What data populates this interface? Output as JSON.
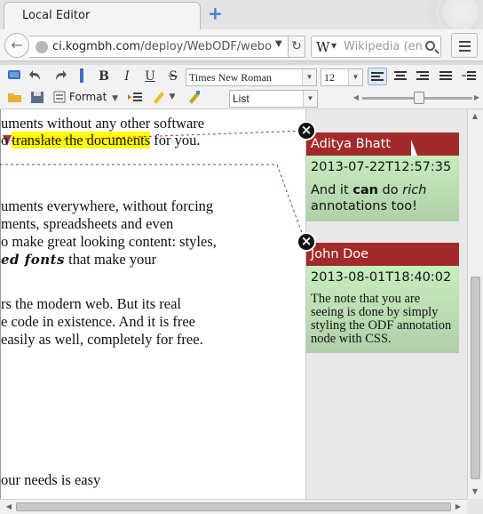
{
  "browser": {
    "tab_title": "Local Editor",
    "url_domain": "ci.kogmbh.com",
    "url_path": "/deploy/WebODF/webo",
    "search_placeholder": "Wikipedia (en"
  },
  "toolbar": {
    "font_name": "Times New Roman",
    "font_size": "12",
    "format_label": "Format",
    "list_style": "List"
  },
  "document": {
    "lines": {
      "l1": "uments without any other software",
      "l2_pre": "o ",
      "l2_hl": "translate the documents",
      "l2_post": " for you.",
      "l3": "uments everywhere, without forcing",
      "l4": "ments, spreadsheets and even",
      "l5": "o make great looking content: styles,",
      "l6_fancy": "ed fonts",
      "l6_post": " that make your",
      "l7": "rs the modern web. But its real",
      "l8": "e code in existence. And it is free",
      "l9": "easily as well, completely for free.",
      "l10": "our needs is easy"
    }
  },
  "annotations": [
    {
      "author": "Aditya Bhatt",
      "date": "2013-07-22T12:57:35",
      "text_a": "And it ",
      "text_b": "can",
      "text_c": " do ",
      "text_d": "rich",
      "text_e": "annotations too!"
    },
    {
      "author": "John Doe",
      "date": "2013-08-01T18:40:02",
      "text": "The note that you are seeing is done by simply styling the ODF annotation node with CSS."
    }
  ],
  "colors": {
    "note_header": "#a32a2a",
    "note_body": "#c6f0bd",
    "highlight": "#ffff00"
  }
}
